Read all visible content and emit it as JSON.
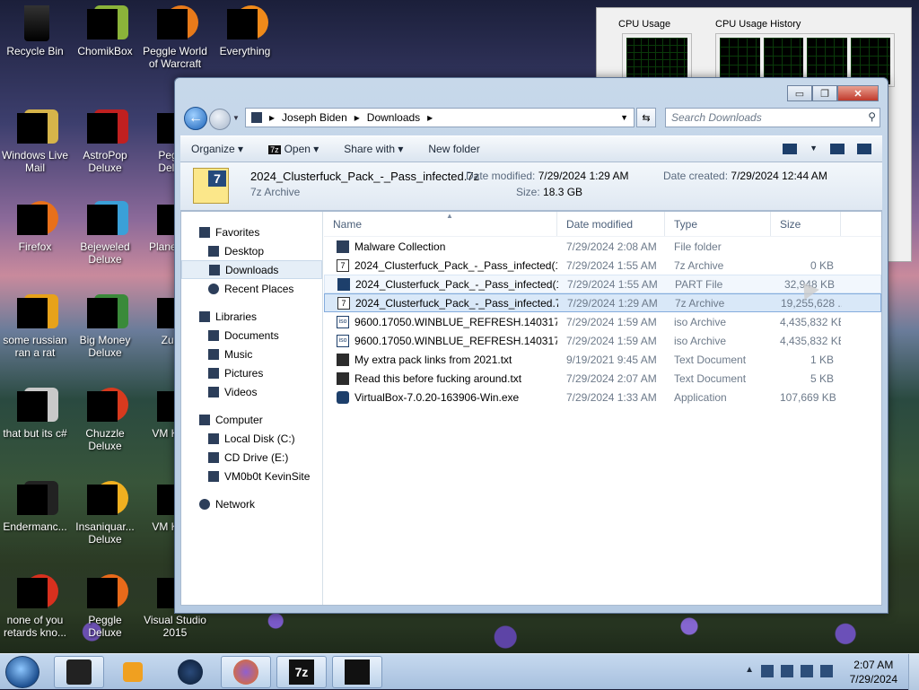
{
  "desktop": {
    "icons": [
      {
        "label": "Recycle Bin"
      },
      {
        "label": "ChomikBox"
      },
      {
        "label": "Peggle World of Warcraft"
      },
      {
        "label": "Everything"
      },
      {
        "label": "Windows Live Mail"
      },
      {
        "label": "AstroPop Deluxe"
      },
      {
        "label": "Peggle Deluxe"
      },
      {
        "label": "Firefox"
      },
      {
        "label": "Bejeweled Deluxe"
      },
      {
        "label": "Planet Zoo"
      },
      {
        "label": "some russian ran a rat"
      },
      {
        "label": "Big Money Deluxe"
      },
      {
        "label": "Zuma"
      },
      {
        "label": "that but its c#"
      },
      {
        "label": "Chuzzle Deluxe"
      },
      {
        "label": "VM Kevin"
      },
      {
        "label": "Endermanc..."
      },
      {
        "label": "Insaniquar... Deluxe"
      },
      {
        "label": "VM Kevin"
      },
      {
        "label": "none of you retards kno..."
      },
      {
        "label": "Peggle Deluxe"
      },
      {
        "label": "Visual Studio 2015"
      }
    ]
  },
  "gadget": {
    "cpu_usage_label": "CPU Usage",
    "cpu_history_label": "CPU Usage History"
  },
  "window": {
    "address": {
      "segments": [
        "Joseph Biden",
        "Downloads"
      ]
    },
    "search_placeholder": "Search Downloads",
    "caption": {
      "min": "▭",
      "max": "❐",
      "close": "✕"
    },
    "toolbar": {
      "organize": "Organize ▾",
      "open": "Open ▾",
      "share": "Share with ▾",
      "new_folder": "New folder"
    },
    "details": {
      "name": "2024_Clusterfuck_Pack_-_Pass_infected.7z",
      "type": "7z Archive",
      "modified_label": "Date modified:",
      "modified": "7/29/2024 1:29 AM",
      "size_label": "Size:",
      "size": "18.3 GB",
      "created_label": "Date created:",
      "created": "7/29/2024 12:44 AM"
    },
    "nav": {
      "favorites": "Favorites",
      "desktop": "Desktop",
      "downloads": "Downloads",
      "recent": "Recent Places",
      "libraries": "Libraries",
      "documents": "Documents",
      "music": "Music",
      "pictures": "Pictures",
      "videos": "Videos",
      "computer": "Computer",
      "local_disk": "Local Disk (C:)",
      "cd_drive": "CD Drive (E:)",
      "vm": "VM0b0t KevinSite",
      "network": "Network"
    },
    "columns": {
      "name": "Name",
      "date": "Date modified",
      "type": "Type",
      "size": "Size"
    },
    "files": [
      {
        "name": "Malware Collection",
        "date": "7/29/2024 2:08 AM",
        "type": "File folder",
        "size": ""
      },
      {
        "name": "2024_Clusterfuck_Pack_-_Pass_infected(1...",
        "date": "7/29/2024 1:55 AM",
        "type": "7z Archive",
        "size": "0 KB"
      },
      {
        "name": "2024_Clusterfuck_Pack_-_Pass_infected(1...",
        "date": "7/29/2024 1:55 AM",
        "type": "PART File",
        "size": "32,948 KB"
      },
      {
        "name": "2024_Clusterfuck_Pack_-_Pass_infected.7z",
        "date": "7/29/2024 1:29 AM",
        "type": "7z Archive",
        "size": "19,255,628 ..."
      },
      {
        "name": "9600.17050.WINBLUE_REFRESH.140317-1...",
        "date": "7/29/2024 1:59 AM",
        "type": "iso Archive",
        "size": "4,435,832 KB"
      },
      {
        "name": "9600.17050.WINBLUE_REFRESH.140317-1...",
        "date": "7/29/2024 1:59 AM",
        "type": "iso Archive",
        "size": "4,435,832 KB"
      },
      {
        "name": "My extra pack links from 2021.txt",
        "date": "9/19/2021 9:45 AM",
        "type": "Text Document",
        "size": "1 KB"
      },
      {
        "name": "Read this before fucking around.txt",
        "date": "7/29/2024 2:07 AM",
        "type": "Text Document",
        "size": "5 KB"
      },
      {
        "name": "VirtualBox-7.0.20-163906-Win.exe",
        "date": "7/29/2024 1:33 AM",
        "type": "Application",
        "size": "107,669 KB"
      }
    ]
  },
  "taskbar": {
    "time": "2:07 AM",
    "date": "7/29/2024"
  }
}
